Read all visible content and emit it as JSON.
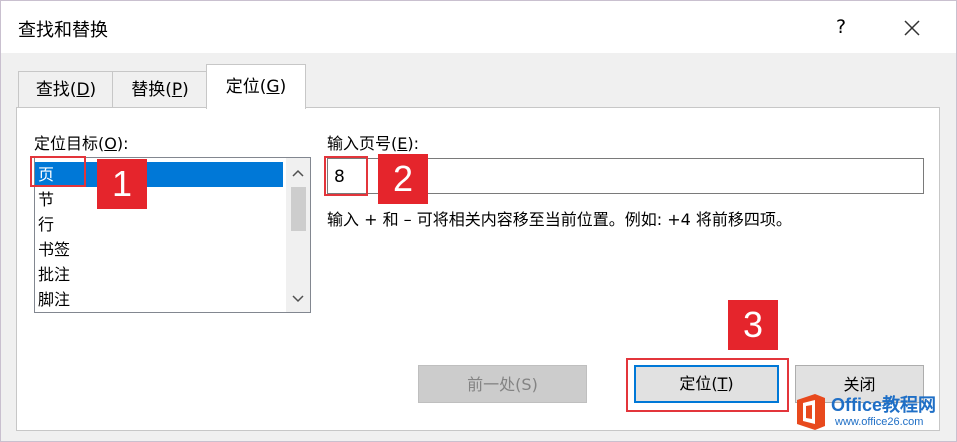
{
  "window": {
    "title": "查找和替换",
    "help_label": "?"
  },
  "tabs": [
    {
      "label": "查找",
      "hotkey": "(D)",
      "hotkey_letter": "D"
    },
    {
      "label": "替换",
      "hotkey": "(P)",
      "hotkey_letter": "P"
    },
    {
      "label": "定位",
      "hotkey": "(G)",
      "hotkey_letter": "G",
      "active": true
    }
  ],
  "goto": {
    "target_label": "定位目标",
    "target_hotkey_letter": "O",
    "target_items": [
      "页",
      "节",
      "行",
      "书签",
      "批注",
      "脚注"
    ],
    "selected_index": 0,
    "page_label": "输入页号",
    "page_hotkey_letter": "E",
    "page_value": "8",
    "hint": "输入 + 和 – 可将相关内容移至当前位置。例如: +4 将前移四项。"
  },
  "buttons": {
    "previous_label": "前一处(S)",
    "goto_label": "定位",
    "goto_hotkey_letter": "T",
    "close_label": "关闭"
  },
  "annotations": [
    "1",
    "2",
    "3"
  ],
  "watermark": {
    "line1": "Office教程网",
    "line2": "www.office26.com"
  },
  "colors": {
    "accent": "#0078d7",
    "annotation_red": "#e5252c",
    "dialog_bg": "#f0f0f0"
  }
}
